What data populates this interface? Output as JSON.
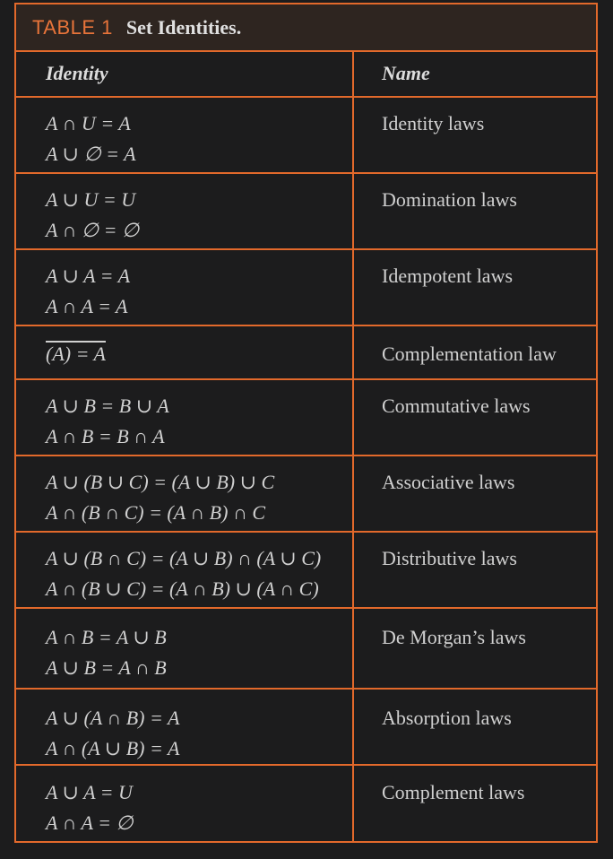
{
  "title": {
    "number": "TABLE 1",
    "text": "Set Identities."
  },
  "header": {
    "identity": "Identity",
    "name": "Name"
  },
  "rows": [
    {
      "identity": [
        "A ∩ U = A",
        "A ∪ ∅ = A"
      ],
      "name": "Identity laws"
    },
    {
      "identity": [
        "A ∪ U = U",
        "A ∩ ∅ = ∅"
      ],
      "name": "Domination laws"
    },
    {
      "identity": [
        "A ∪ A = A",
        "A ∩ A = A"
      ],
      "name": "Idempotent laws"
    },
    {
      "identity": [
        "(A) = A"
      ],
      "name": "Complementation law"
    },
    {
      "identity": [
        "A ∪ B = B ∪ A",
        "A ∩ B = B ∩ A"
      ],
      "name": "Commutative laws"
    },
    {
      "identity": [
        "A ∪ (B ∪ C) = (A ∪ B) ∪ C",
        "A ∩ (B ∩ C) = (A ∩ B) ∩ C"
      ],
      "name": "Associative laws"
    },
    {
      "identity": [
        "A ∪ (B ∩ C) = (A ∪ B) ∩ (A ∪ C)",
        "A ∩ (B ∪ C) = (A ∩ B) ∪ (A ∩ C)"
      ],
      "name": "Distributive laws"
    },
    {
      "identity": [
        "A ∩ B = A ∪ B",
        "A ∪ B = A ∩ B"
      ],
      "name": "De Morgan’s laws"
    },
    {
      "identity": [
        "A ∪ (A ∩ B) = A",
        "A ∩ (A ∪ B) = A"
      ],
      "name": "Absorption laws"
    },
    {
      "identity": [
        "A ∪ A = U",
        "A ∩ A = ∅"
      ],
      "name": "Complement laws"
    }
  ],
  "colors": {
    "border": "#e2692b",
    "background": "#1c1c1d",
    "title_number": "#e8743a"
  }
}
